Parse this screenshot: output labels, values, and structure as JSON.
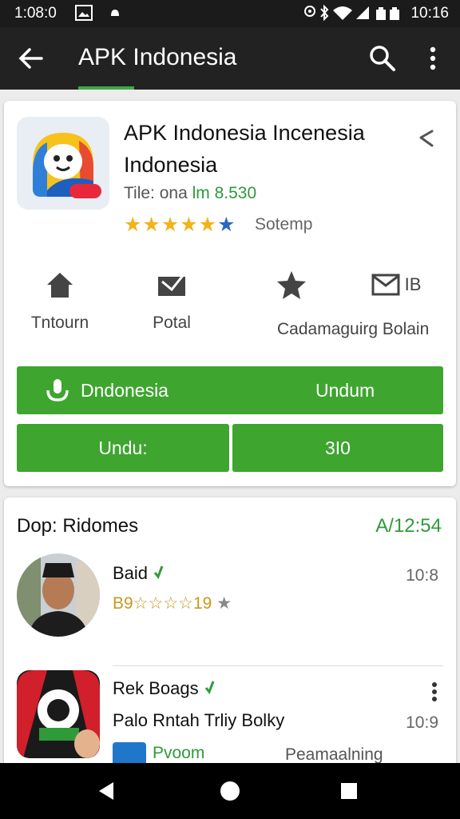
{
  "status_bar": {
    "time_left": "1:08:0",
    "time_right": "10:16"
  },
  "app_bar": {
    "title": "APK Indonesia"
  },
  "app_card": {
    "name": "APK Indonesia Incenesia Indonesia",
    "meta_prefix": "Tile: ona",
    "meta_value": "lm 8.530",
    "rating_stars": "★★★★★",
    "rating_half": "★",
    "rating_label": "Sotemp",
    "actions": [
      {
        "label": "Tntourn",
        "icon": "home-icon"
      },
      {
        "label": "Potal",
        "icon": "inbox-icon"
      },
      {
        "label": "Cadamaguirg Bolain",
        "icon": "star-icon"
      },
      {
        "label": "IB",
        "icon": "mail-icon"
      }
    ],
    "primary_button": {
      "left_label": "Dndonesia",
      "right_label": "Undum"
    },
    "secondary_buttons": [
      "Undu:",
      "3I0"
    ]
  },
  "reviews": {
    "header": "Dop: Ridomes",
    "header_time": "A/12:54",
    "items": [
      {
        "name": "Baid",
        "time": "10:8",
        "stars": "B9☆☆☆☆19",
        "grey_star": "★"
      },
      {
        "name": "Rek Boags",
        "subtitle": "Palo Rntah Trliy Bolky",
        "time": "10:9",
        "tag": "Pvoom",
        "tag_right": "Peamaalning"
      }
    ]
  },
  "colors": {
    "accent_green": "#3ea52f",
    "app_bar": "#222222",
    "status_bar": "#1b1b1b"
  }
}
